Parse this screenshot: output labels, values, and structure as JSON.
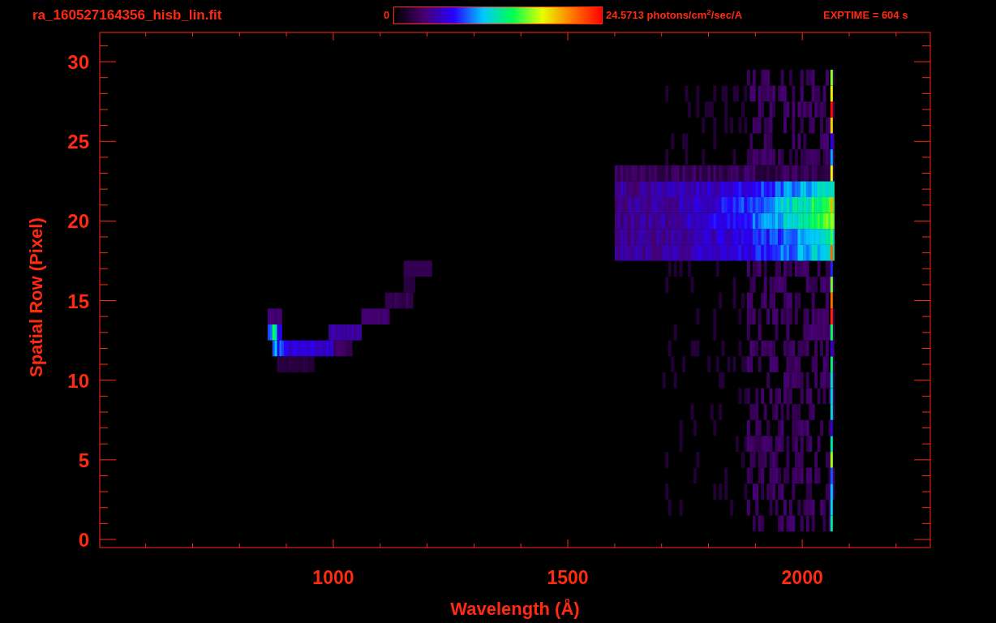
{
  "header": {
    "filename": "ra_160527164356_hisb_lin.fit",
    "colorbar": {
      "min_label": "0",
      "max_label": "24.5713 photons/cm$^{2}$/sec/A"
    },
    "exposure": "EXPTIME = 604 s"
  },
  "plot": {
    "xlabel": "Wavelength (Å)",
    "ylabel": "Spatial Row (Pixel)",
    "xticks": [
      "1000",
      "1500",
      "2000"
    ],
    "yticks": [
      "30",
      "25",
      "20",
      "15",
      "10",
      "5",
      "0"
    ]
  }
}
